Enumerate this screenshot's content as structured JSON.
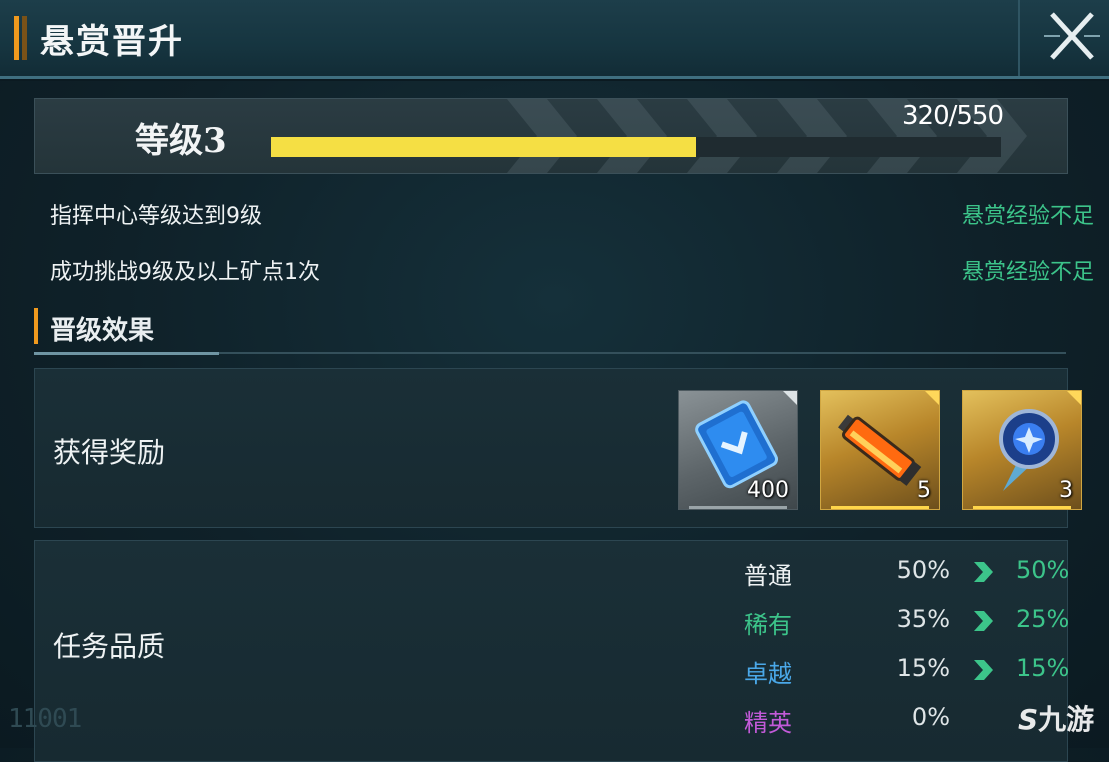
{
  "header": {
    "title": "悬赏晋升",
    "close_icon": "close-x-icon"
  },
  "level": {
    "label": "等级3",
    "progress_text": "320/550",
    "progress_current": 320,
    "progress_max": 550,
    "bar_color": "#f5df44"
  },
  "requirements": [
    {
      "text": "指挥中心等级达到9级",
      "status": "悬赏经验不足"
    },
    {
      "text": "成功挑战9级及以上矿点1次",
      "status": "悬赏经验不足"
    }
  ],
  "section": {
    "title": "晋级效果"
  },
  "rewards": {
    "label": "获得奖励",
    "items": [
      {
        "icon": "blue-card-icon",
        "quantity": "400",
        "rarity": "common"
      },
      {
        "icon": "orange-tube-icon",
        "quantity": "5",
        "rarity": "gold"
      },
      {
        "icon": "blue-crystal-shield-icon",
        "quantity": "3",
        "rarity": "gold"
      }
    ]
  },
  "quality": {
    "label": "任务品质",
    "rows": [
      {
        "name": "普通",
        "color": "#eef2f3",
        "from": "50%",
        "to": "50%"
      },
      {
        "name": "稀有",
        "color": "#3cc48a",
        "from": "35%",
        "to": "25%"
      },
      {
        "name": "卓越",
        "color": "#4aa8e8",
        "from": "15%",
        "to": "15%"
      },
      {
        "name": "精英",
        "color": "#c25ad8",
        "from": "0%",
        "to": ""
      }
    ]
  },
  "watermarks": {
    "left": "11001",
    "right_logo": "九游"
  },
  "colors": {
    "accent": "#f09a1e",
    "status_green": "#3cc48a"
  }
}
